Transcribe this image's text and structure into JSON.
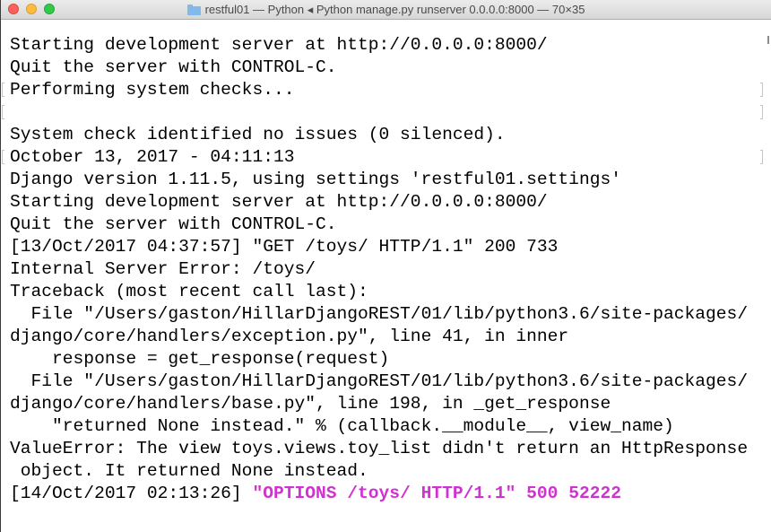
{
  "window": {
    "title": "restful01 — Python ◂ Python manage.py runserver 0.0.0.0:8000 — 70×35",
    "title_icon": "folder-icon",
    "controls": [
      "close",
      "minimize",
      "maximize"
    ]
  },
  "terminal": {
    "text_color": "#000000",
    "background": "#ffffff",
    "highlight_color": "#d131d1",
    "lines": [
      "Starting development server at http://0.0.0.0:8000/",
      "Quit the server with CONTROL-C.",
      "Performing system checks...",
      "",
      "System check identified no issues (0 silenced).",
      "October 13, 2017 - 04:11:13",
      "Django version 1.11.5, using settings 'restful01.settings'",
      "Starting development server at http://0.0.0.0:8000/",
      "Quit the server with CONTROL-C.",
      "[13/Oct/2017 04:37:57] \"GET /toys/ HTTP/1.1\" 200 733",
      "Internal Server Error: /toys/",
      "Traceback (most recent call last):",
      "  File \"/Users/gaston/HillarDjangoREST/01/lib/python3.6/site-packages/",
      "django/core/handlers/exception.py\", line 41, in inner",
      "    response = get_response(request)",
      "  File \"/Users/gaston/HillarDjangoREST/01/lib/python3.6/site-packages/",
      "django/core/handlers/base.py\", line 198, in _get_response",
      "    \"returned None instead.\" % (callback.__module__, view_name)",
      "ValueError: The view toys.views.toy_list didn't return an HttpResponse",
      " object. It returned None instead."
    ],
    "last_line": {
      "prefix": "[14/Oct/2017 02:13:26] ",
      "highlight": "\"OPTIONS /toys/ HTTP/1.1\" 500 52222"
    }
  }
}
